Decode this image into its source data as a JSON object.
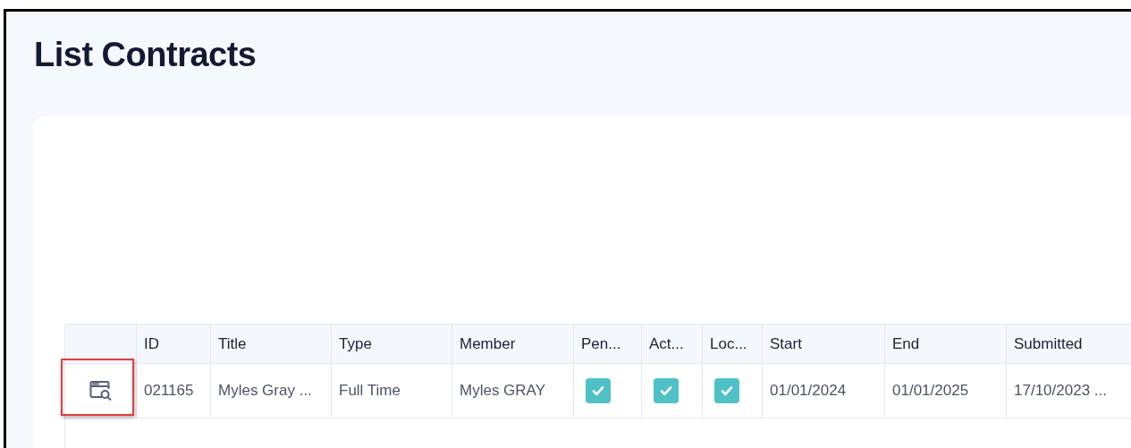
{
  "page": {
    "title": "List Contracts"
  },
  "table": {
    "columns": [
      {},
      {
        "label": "ID"
      },
      {
        "label": "Title"
      },
      {
        "label": "Type"
      },
      {
        "label": "Member"
      },
      {
        "label": "Pen..."
      },
      {
        "label": "Act..."
      },
      {
        "label": "Loc..."
      },
      {
        "label": "Start"
      },
      {
        "label": "End"
      },
      {
        "label": "Submitted"
      }
    ],
    "rows": [
      {
        "action_highlighted": true,
        "id": "021165",
        "title": "Myles Gray ...",
        "type": "Full Time",
        "member": "Myles GRAY",
        "pending": true,
        "active": true,
        "locked": true,
        "start": "01/01/2024",
        "end": "01/01/2025",
        "submitted": "17/10/2023 ..."
      }
    ]
  }
}
